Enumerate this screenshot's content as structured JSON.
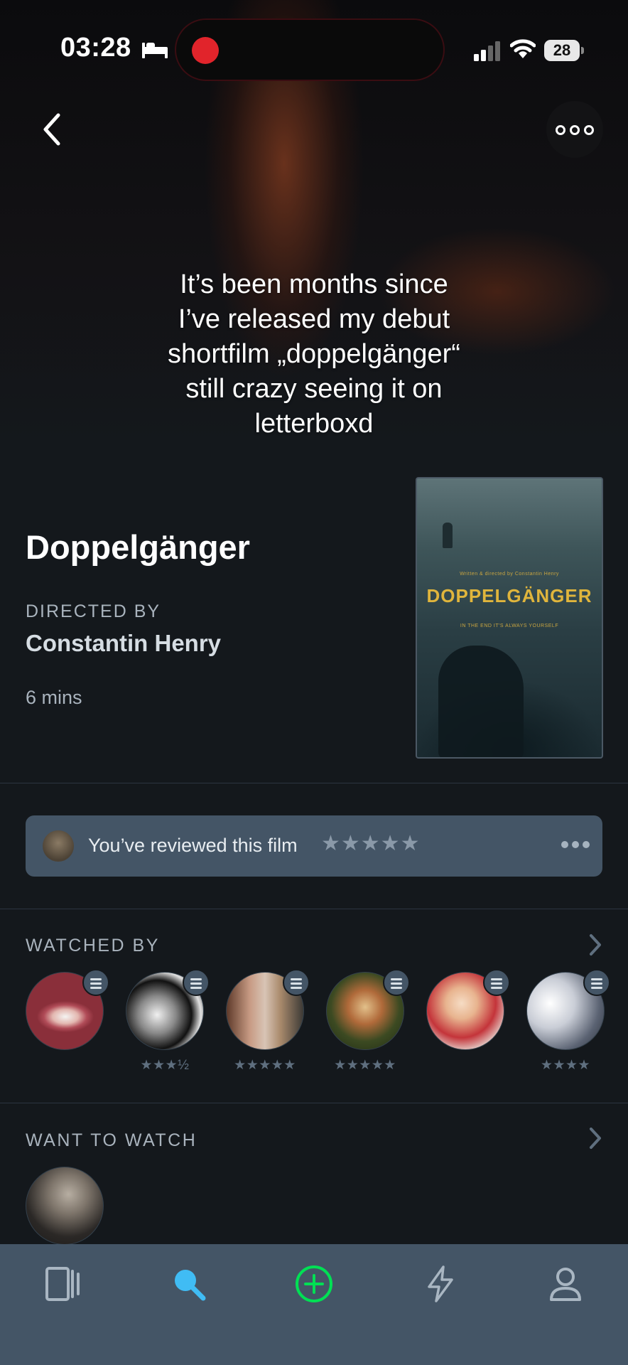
{
  "status_bar": {
    "time": "03:28",
    "battery": "28"
  },
  "caption": "It’s been months since\nI’ve released my debut\nshortfilm „doppelgänger“\nstill crazy seeing it on\nletterboxd",
  "film": {
    "title": "Doppelgänger",
    "directed_by_label": "DIRECTED BY",
    "director": "Constantin Henry",
    "runtime": "6 mins",
    "poster": {
      "credit": "Written & directed by Constantin Henry",
      "title": "DOPPELGÄNGER",
      "tagline": "IN THE END IT'S ALWAYS YOURSELF"
    }
  },
  "review": {
    "text": "You’ve reviewed this film",
    "stars": "★★★★★"
  },
  "watched_by": {
    "label": "WATCHED BY",
    "friends": [
      {
        "stars": ""
      },
      {
        "stars": "★★★½"
      },
      {
        "stars": "★★★★★"
      },
      {
        "stars": "★★★★★"
      },
      {
        "stars": ""
      },
      {
        "stars": "★★★★"
      }
    ]
  },
  "want_to_watch": {
    "label": "WANT TO WATCH"
  },
  "tabbar": {
    "items": [
      "films-icon",
      "search-icon",
      "add-icon",
      "activity-icon",
      "profile-icon"
    ],
    "active": "search-icon",
    "colors": {
      "active": "#40bcf4",
      "add": "#00e054",
      "inactive": "#a9b6c2"
    }
  }
}
